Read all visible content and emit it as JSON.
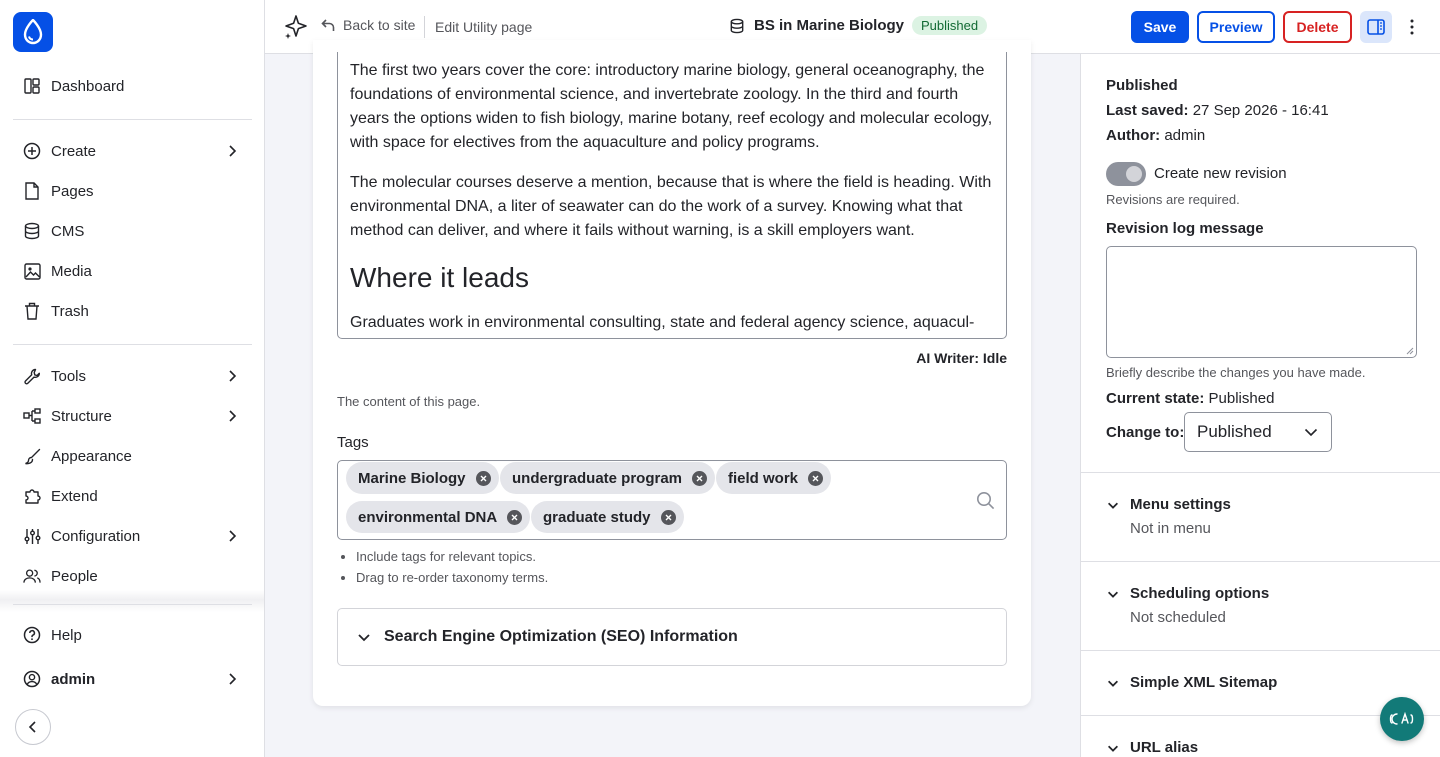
{
  "sidebar": {
    "items": [
      {
        "label": "Dashboard"
      },
      {
        "label": "Create"
      },
      {
        "label": "Pages"
      },
      {
        "label": "CMS"
      },
      {
        "label": "Media"
      },
      {
        "label": "Trash"
      },
      {
        "label": "Tools"
      },
      {
        "label": "Structure"
      },
      {
        "label": "Appearance"
      },
      {
        "label": "Extend"
      },
      {
        "label": "Configuration"
      },
      {
        "label": "People"
      },
      {
        "label": "Help"
      },
      {
        "label": "admin"
      }
    ]
  },
  "topbar": {
    "back_label": "Back to site",
    "edit_label": "Edit Utility page",
    "page_title": "BS in Marine Biology",
    "status_badge": "Published",
    "save_label": "Save",
    "preview_label": "Preview",
    "delete_label": "Delete"
  },
  "editor": {
    "paragraph1": "The first two years cover the core: introductory marine biology, general oceanography, the foundations of environmental science, and invertebrate zoology. In the third and fourth years the options widen to fish biology, marine botany, reef ecology and molecular ecology, with space for electives from the aquaculture and policy programs.",
    "paragraph2": "The molecular courses deserve a mention, because that is where the field is heading. With environmental DNA, a liter of seawater can do the work of a survey. Knowing what that method can deliver, and where it fails without warning, is a skill employers want.",
    "heading": "Where it leads",
    "paragraph3": "Graduates work in environmental consulting, state and federal agency science, aquacul-",
    "ai_status": "AI Writer: Idle",
    "description": "The content of this page."
  },
  "tags": {
    "label": "Tags",
    "items": [
      "Marine Biology",
      "undergraduate program",
      "field work",
      "environmental DNA",
      "graduate study"
    ],
    "help": [
      "Include tags for relevant topics.",
      "Drag to re-order taxonomy terms."
    ]
  },
  "seo": {
    "label": "Search Engine Optimization (SEO) Information"
  },
  "panel": {
    "status": "Published",
    "last_saved_label": "Last saved:",
    "last_saved_value": "27 Sep 2026 - 16:41",
    "author_label": "Author:",
    "author_value": "admin",
    "revision_toggle_label": "Create new revision",
    "revision_required": "Revisions are required.",
    "revision_log_label": "Revision log message",
    "revision_log_help": "Briefly describe the changes you have made.",
    "current_state_label": "Current state:",
    "current_state_value": "Published",
    "change_to_label": "Change to:",
    "change_to_value": "Published",
    "accordions": [
      {
        "title": "Menu settings",
        "summary": "Not in menu"
      },
      {
        "title": "Scheduling options",
        "summary": "Not scheduled"
      },
      {
        "title": "Simple XML Sitemap",
        "summary": ""
      },
      {
        "title": "URL alias",
        "summary": ""
      }
    ]
  },
  "colors": {
    "accent": "#0550e6",
    "danger": "#d72222",
    "published_bg": "#dcf3e3",
    "fab": "#127a78"
  }
}
